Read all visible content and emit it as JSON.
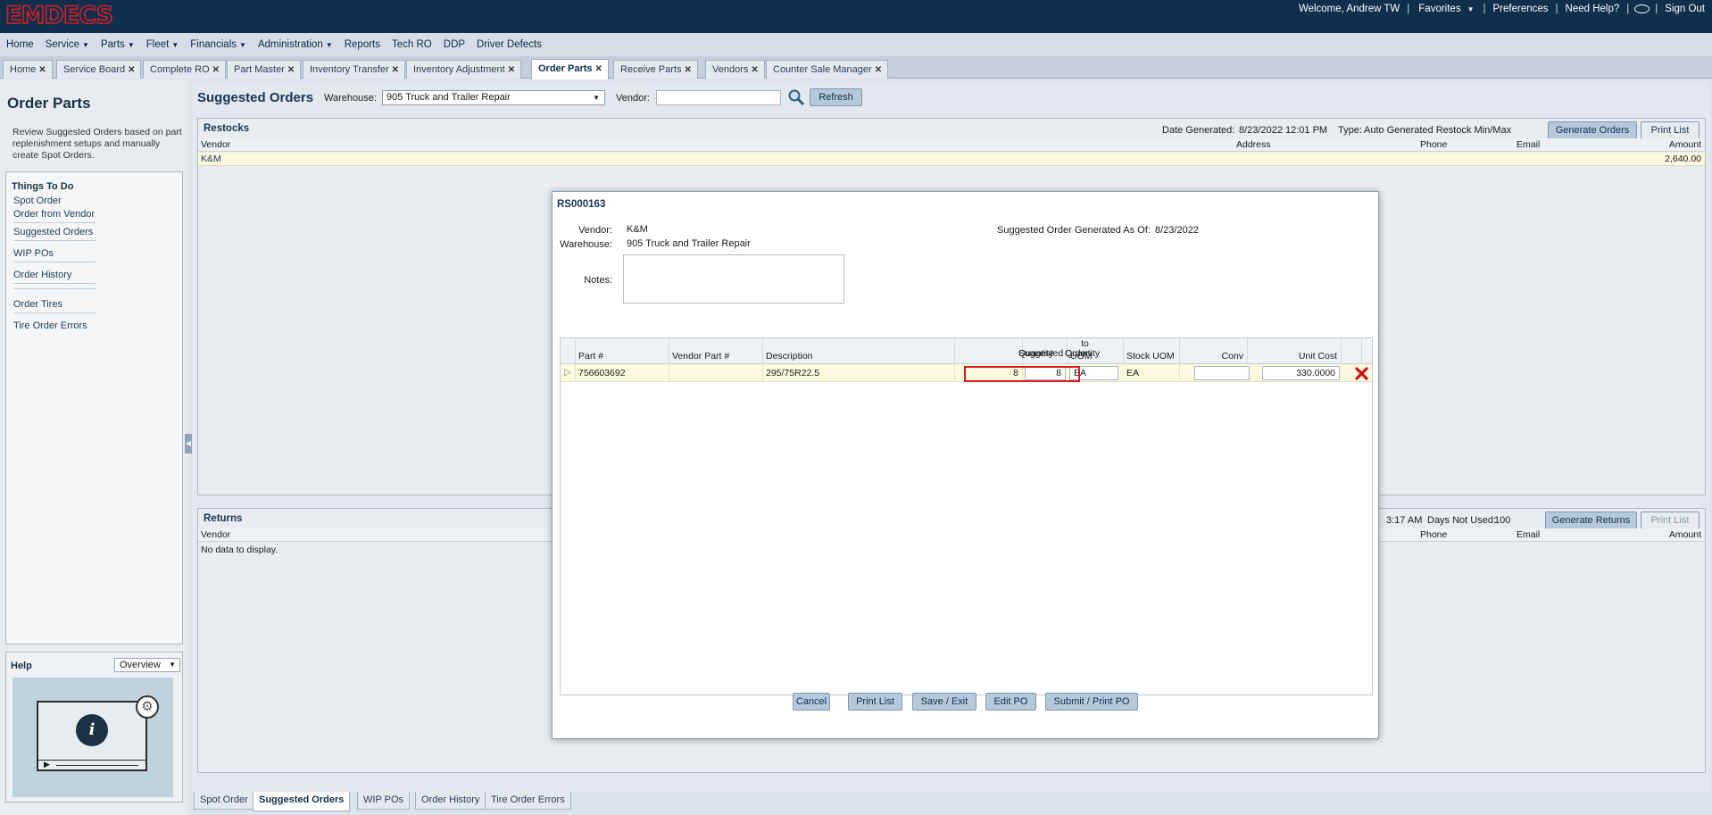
{
  "app": {
    "logo": "EMDECS"
  },
  "toplinks": {
    "welcome": "Welcome, Andrew TW",
    "favorites": "Favorites",
    "preferences": "Preferences",
    "help": "Need Help?",
    "signout": "Sign Out"
  },
  "menu": [
    "Home",
    "Service",
    "Parts",
    "Fleet",
    "Financials",
    "Administration",
    "Reports",
    "Tech RO",
    "DDP",
    "Driver Defects"
  ],
  "menu_dropdown": [
    false,
    true,
    true,
    true,
    true,
    true,
    false,
    false,
    false,
    false
  ],
  "tabs": [
    "Home",
    "Service Board",
    "Complete RO",
    "Part Master",
    "Inventory Transfer",
    "Inventory Adjustment",
    "Order Parts",
    "Receive Parts",
    "Vendors",
    "Counter Sale Manager"
  ],
  "sidebar": {
    "title": "Order Parts",
    "description": "Review Suggested Orders based on part replenishment setups and manually create Spot Orders.",
    "things_title": "Things To Do",
    "links": [
      "Spot Order",
      "Order from Vendor",
      "Suggested Orders",
      "WIP POs",
      "Order History",
      "Order Tires",
      "Tire Order Errors"
    ],
    "help_title": "Help",
    "help_select": "Overview"
  },
  "main": {
    "title": "Suggested Orders",
    "warehouse_label": "Warehouse:",
    "warehouse_value": "905 Truck and Trailer Repair",
    "vendor_label": "Vendor:",
    "refresh": "Refresh",
    "restocks": {
      "title": "Restocks",
      "date_label": "Date Generated:",
      "date_value": "8/23/2022 12:01 PM",
      "type_label": "Type:",
      "type_value": "Auto Generated Restock Min/Max",
      "generate": "Generate Orders",
      "print": "Print List",
      "columns": {
        "vendor": "Vendor",
        "address": "Address",
        "phone": "Phone",
        "email": "Email",
        "amount": "Amount"
      },
      "row": {
        "vendor": "K&M",
        "amount": "2,640.00"
      }
    },
    "returns": {
      "title": "Returns",
      "time_partial": "3:17 AM",
      "days_label": "Days Not Used:",
      "days_value": "100",
      "generate": "Generate Returns",
      "print": "Print List",
      "columns": {
        "vendor": "Vendor",
        "phone": "Phone",
        "email": "Email",
        "amount": "Amount"
      },
      "empty": "No data to display."
    }
  },
  "bottom_tabs": [
    "Spot Order",
    "Suggested Orders",
    "WIP POs",
    "Order History",
    "Tire Order Errors"
  ],
  "modal": {
    "rs": "RS000163",
    "vendor_label": "Vendor:",
    "vendor": "K&M",
    "warehouse_label": "Warehouse:",
    "warehouse": "905 Truck and Trailer Repair",
    "generated_label": "Suggested Order Generated As Of:",
    "generated": "8/23/2022",
    "notes_label": "Notes:",
    "columns": {
      "part": "Part #",
      "vendor_part": "Vendor Part #",
      "description": "Description",
      "sugg1": "Suggested",
      "sugg2": "Quantity",
      "qty1": "Quantity",
      "qty2": "to Order",
      "uom": "UOM",
      "stock_uom": "Stock UOM",
      "conv": "Conv",
      "unit_cost": "Unit Cost"
    },
    "row": {
      "part": "756603692",
      "vendor_part": "",
      "description": "295/75R22.5",
      "suggested": "8",
      "qty": "8",
      "uom": "EA",
      "stock_uom": "EA",
      "conv": "",
      "unit_cost": "330.0000"
    },
    "buttons": {
      "cancel": "Cancel",
      "print": "Print List",
      "save": "Save / Exit",
      "edit": "Edit PO",
      "submit": "Submit / Print PO"
    }
  },
  "colors": {
    "topbar": "#0f2f4c",
    "logo": "#d51f26",
    "highlight_box": "#e0191f",
    "row_highlight": "#fcf9df"
  }
}
